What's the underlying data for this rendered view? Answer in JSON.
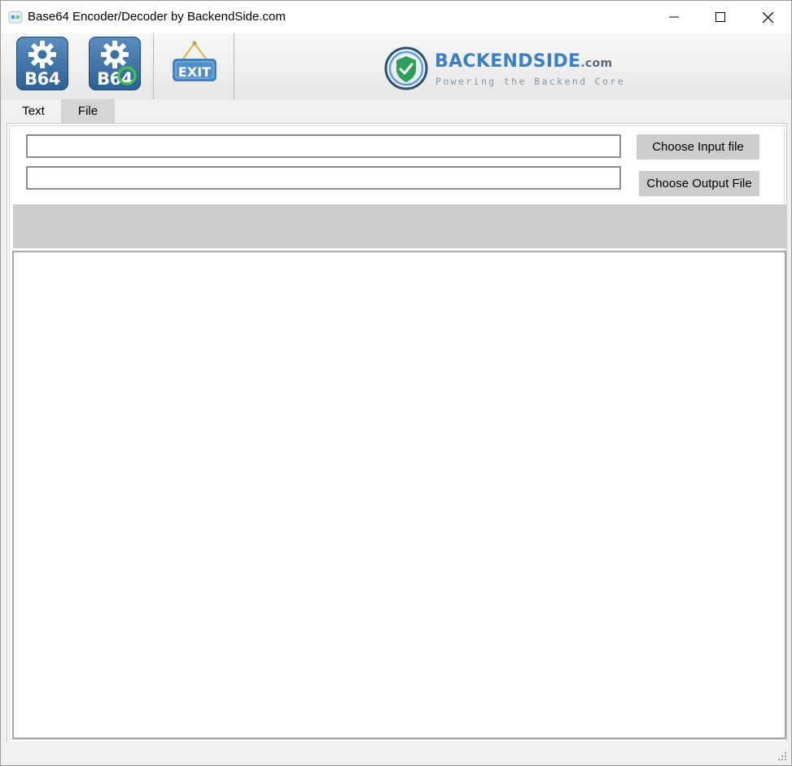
{
  "window": {
    "title": "Base64 Encoder/Decoder by BackendSide.com",
    "icons": {
      "app": "app-icon",
      "minimize": "minimize-icon",
      "maximize": "maximize-icon",
      "close": "close-icon"
    }
  },
  "toolbar": {
    "encode": {
      "label": "B64",
      "icon": "encode-gear-icon"
    },
    "decode": {
      "label": "B64",
      "icon": "decode-gear-icon"
    },
    "exit": {
      "label": "EXIT",
      "icon": "exit-sign-icon"
    }
  },
  "logo": {
    "name": "BACKENDSIDE",
    "suffix": ".com",
    "tagline": "Powering the Backend Core",
    "icon": "shield-check-icon"
  },
  "tabs": [
    {
      "label": "Text",
      "active": true
    },
    {
      "label": "File",
      "active": false
    }
  ],
  "file_panel": {
    "input_path": "",
    "output_path": "",
    "choose_input_label": "Choose Input file",
    "choose_output_label": "Choose Output File",
    "output_text": ""
  },
  "colors": {
    "brand_blue": "#3b7fc4",
    "button_gray": "#cccccc",
    "band_gray": "#cccccc"
  }
}
